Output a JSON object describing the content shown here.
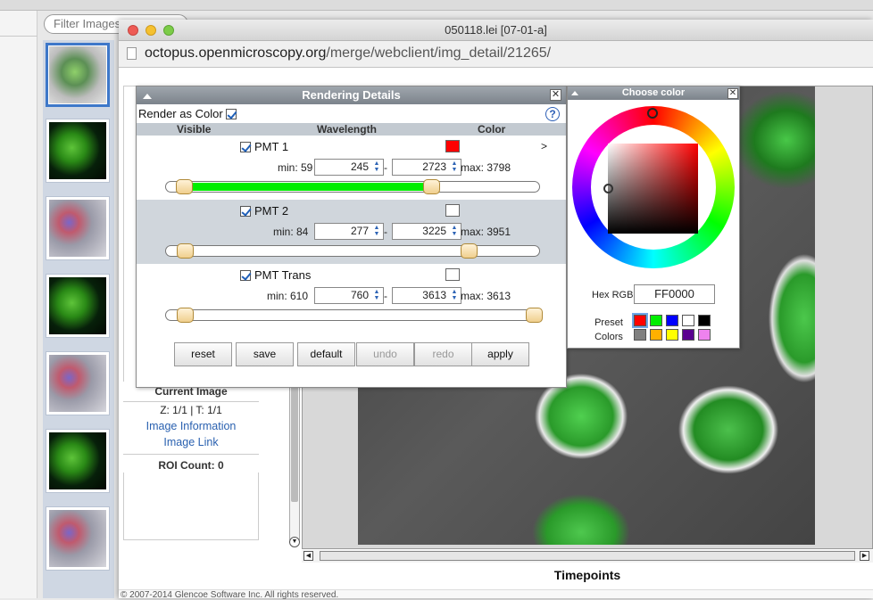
{
  "background": {
    "filter_placeholder": "Filter Images",
    "thumbnails": [
      {
        "kind": "gray",
        "selected": true
      },
      {
        "kind": "green"
      },
      {
        "kind": "mix"
      },
      {
        "kind": "green"
      },
      {
        "kind": "mix"
      },
      {
        "kind": "green"
      },
      {
        "kind": "mix"
      }
    ]
  },
  "window": {
    "title": "050118.lei [07-01-a]",
    "url_host": "octopus.openmicroscopy.org",
    "url_path": "/merge/webclient/img_detail/21265/"
  },
  "left_panel": {
    "current_image_header": "Current Image",
    "z_t": "Z: 1/1 | T: 1/1",
    "image_information": "Image Information",
    "image_link": "Image Link",
    "roi_count": "ROI Count: 0"
  },
  "viewer": {
    "timepoints_label": "Timepoints",
    "footer": "© 2007-2014 Glencoe Software Inc. All rights reserved."
  },
  "rendering_dialog": {
    "title": "Rendering Details",
    "render_as_color": "Render as Color",
    "help": "?",
    "col_visible": "Visible",
    "col_wavelength": "Wavelength",
    "col_color": "Color",
    "expand": ">",
    "channels": [
      {
        "name": "PMT 1",
        "color": "#ff0000",
        "min_label": "min: 59",
        "start": "245",
        "end": "2723",
        "max_label": "max: 3798",
        "fill": "#00ee00",
        "start_frac": 0.049,
        "end_frac": 0.711
      },
      {
        "name": "PMT 2",
        "color": "#ffffff",
        "min_label": "min: 84",
        "start": "277",
        "end": "3225",
        "max_label": "max: 3951",
        "fill": "#ffffff",
        "start_frac": 0.05,
        "end_frac": 0.812
      },
      {
        "name": "PMT Trans",
        "color": "#ffffff",
        "min_label": "min: 610",
        "start": "760",
        "end": "3613",
        "max_label": "max: 3613",
        "fill": "#ffffff",
        "start_frac": 0.05,
        "end_frac": 1.0
      }
    ],
    "buttons": {
      "reset": "reset",
      "save": "save",
      "default": "default",
      "undo": "undo",
      "redo": "redo",
      "apply": "apply"
    }
  },
  "choose_color": {
    "title": "Choose color",
    "hex_label": "Hex RGB",
    "hex_value": "FF0000",
    "preset_label": "Preset",
    "colors_label": "Colors",
    "presets": [
      "#ff0000",
      "#00ee00",
      "#0000ff",
      "#ffffff",
      "#000000",
      "#808080",
      "#ffb000",
      "#ffff00",
      "#5a0090",
      "#ee82ee"
    ]
  }
}
